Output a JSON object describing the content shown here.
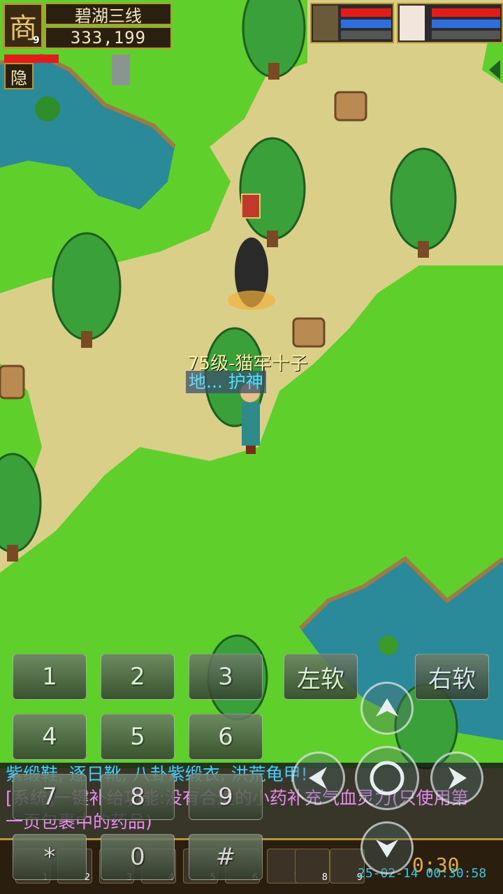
{
  "hud": {
    "portrait_glyph": "商",
    "level": "9",
    "server_name": "碧湖三线",
    "gold": "333,199",
    "hide_button": "隐"
  },
  "npc": {
    "title": "75级-猫牢十子",
    "role": "地... 护神"
  },
  "keypad": {
    "keys": [
      "1",
      "2",
      "3",
      "4",
      "5",
      "6",
      "7",
      "8",
      "9",
      "*",
      "0",
      "#"
    ],
    "left_soft": "左软",
    "right_soft": "右软"
  },
  "chat": {
    "line1": "紫缎鞋, 逐日靴, 八卦紫缎衣, 洪荒龟甲!",
    "line2": "[系统]一键补给功能:没有合适的小药补充气血灵力(只使用第",
    "line3": "一页包裹中的药品)"
  },
  "bottom_bar": {
    "slots": [
      "1",
      "2",
      "3",
      "4",
      "5",
      "6",
      "7",
      "8",
      "9"
    ],
    "timer": "0:30",
    "timestamp": "25-02-14 00:30:58"
  },
  "colors": {
    "grass": "#5fcf2b",
    "path": "#d9cf88",
    "water": "#2b8a9a",
    "hud_gold": "#b8962e"
  }
}
